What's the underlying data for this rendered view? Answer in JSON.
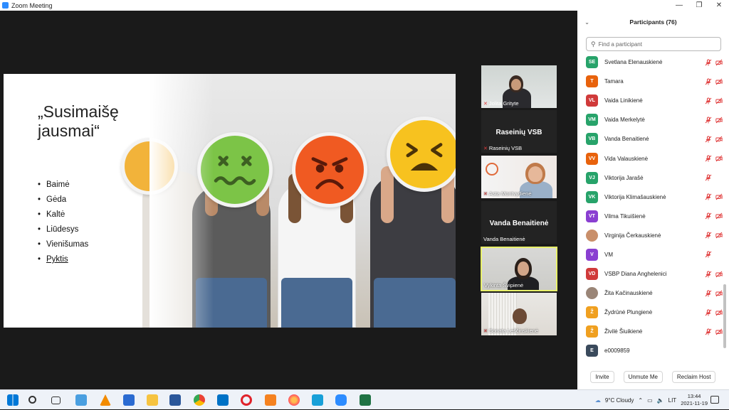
{
  "window": {
    "title": "Zoom Meeting"
  },
  "slide": {
    "title": "„Susimaišę\njausmai“",
    "bullets": [
      "Baimė",
      "Gėda",
      "Kaltė",
      "Liūdesys",
      "Vienišumas",
      "Pyktis"
    ]
  },
  "videos": [
    {
      "name": "Jolita Grityte"
    },
    {
      "name": "Raseinių VSB",
      "display": "Raseinių VSB"
    },
    {
      "name": "Asta Montvydienė"
    },
    {
      "name": "Vanda Benaitienė",
      "display": "Vanda Benaitienė"
    },
    {
      "name": "Vykinta Švipienė"
    },
    {
      "name": "Sonata Leščinskienė"
    }
  ],
  "panel": {
    "title": "Participants (76)",
    "search_placeholder": "Find a participant",
    "participants": [
      {
        "initials": "SE",
        "name": "Svetlana Elenauskienė",
        "color": "#27a36a",
        "video_off": true
      },
      {
        "initials": "T",
        "name": "Tamara",
        "color": "#e8620c",
        "video_off": true
      },
      {
        "initials": "VL",
        "name": "Vaida Linikienė",
        "color": "#d03a3a",
        "video_off": true
      },
      {
        "initials": "VM",
        "name": "Vaida Merkelytė",
        "color": "#27a36a",
        "video_off": true
      },
      {
        "initials": "VB",
        "name": "Vanda Benaitienė",
        "color": "#27a36a",
        "video_off": true
      },
      {
        "initials": "VV",
        "name": "Vida Valauskienė",
        "color": "#e8620c",
        "video_off": true
      },
      {
        "initials": "VJ",
        "name": "Viktorija Jarašė",
        "color": "#27a36a",
        "video_off": false
      },
      {
        "initials": "VK",
        "name": "Viktorija Klimašauskienė",
        "color": "#27a36a",
        "video_off": true
      },
      {
        "initials": "VT",
        "name": "Vilma Tikuišienė",
        "color": "#8a3fd1",
        "video_off": true
      },
      {
        "initials": "",
        "name": "Virginija Čerkauskienė",
        "color": "#c98f6a",
        "video_off": true,
        "photo": true
      },
      {
        "initials": "V",
        "name": "VM",
        "color": "#8a3fd1",
        "video_off": false
      },
      {
        "initials": "VD",
        "name": "VSBP Diana Anghelenici",
        "color": "#d03a3a",
        "video_off": true
      },
      {
        "initials": "",
        "name": "Žita Kačinauskienė",
        "color": "#9a8577",
        "video_off": true,
        "photo": true
      },
      {
        "initials": "Ž",
        "name": "Žydrūnė Plungienė",
        "color": "#f0a020",
        "video_off": true
      },
      {
        "initials": "Ž",
        "name": "Živilė Šiuikienė",
        "color": "#f0a020",
        "video_off": true
      },
      {
        "initials": "E",
        "name": "e0009859",
        "color": "#3a4a5c",
        "video_off": false,
        "no_icons": true
      }
    ],
    "buttons": {
      "invite": "Invite",
      "unmute": "Unmute Me",
      "reclaim": "Reclaim Host"
    }
  },
  "taskbar": {
    "weather": "9°C  Cloudy",
    "lang": "LIT",
    "time": "13:44",
    "date": "2021-11-19"
  }
}
